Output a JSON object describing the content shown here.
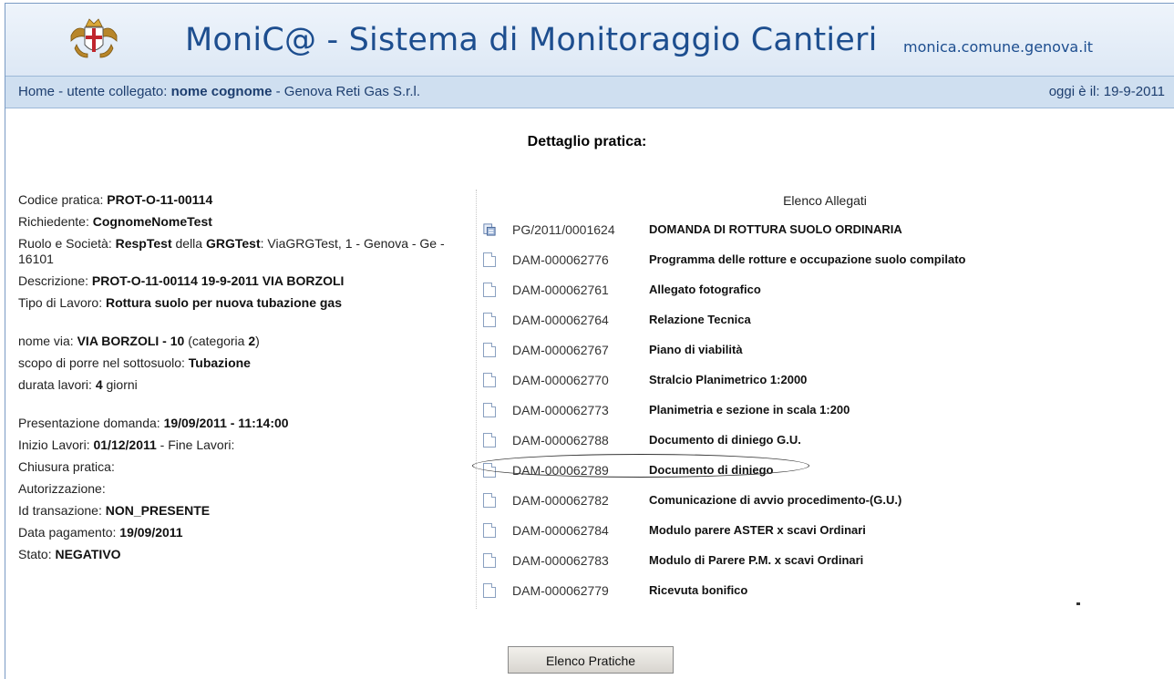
{
  "header": {
    "title": "MoniC@ - Sistema di Monitoraggio Cantieri",
    "url": "monica.comune.genova.it",
    "logo_icon": "genova-coat-of-arms-icon"
  },
  "nav": {
    "prefix": "Home - utente collegato: ",
    "user": "nome cognome",
    "company": " - Genova Reti Gas S.r.l.",
    "date_label": "oggi è il: 19-9-2011"
  },
  "page_heading": "Dettaglio pratica:",
  "details": {
    "codice_label": "Codice pratica: ",
    "codice": "PROT-O-11-00114",
    "richiedente_label": "Richiedente: ",
    "richiedente": "CognomeNomeTest",
    "ruolo_label": "Ruolo e Società: ",
    "ruolo": "RespTest",
    "della": " della ",
    "societa": "GRGTest",
    "indirizzo": ": ViaGRGTest, 1 - Genova - Ge - 16101",
    "descrizione_label": "Descrizione: ",
    "descrizione": "PROT-O-11-00114 19-9-2011 VIA BORZOLI",
    "tipo_label": "Tipo di Lavoro: ",
    "tipo": "Rottura suolo per nuova tubazione gas",
    "via_label": "nome via: ",
    "via": "VIA BORZOLI - 10",
    "categoria_pre": " (categoria ",
    "categoria": "2",
    "categoria_post": ")",
    "scopo_label": "scopo di porre nel sottosuolo: ",
    "scopo": "Tubazione",
    "durata_label": "durata lavori: ",
    "durata": "4",
    "durata_unit": " giorni",
    "presentazione_label": "Presentazione domanda: ",
    "presentazione": "19/09/2011 - 11:14:00",
    "inizio_label": "Inizio Lavori: ",
    "inizio": "01/12/2011",
    "fine_label": " - Fine Lavori:",
    "chiusura_label": "Chiusura pratica:",
    "autorizzazione_label": "Autorizzazione:",
    "transazione_label": "Id transazione: ",
    "transazione": "NON_PRESENTE",
    "pagamento_label": "Data pagamento: ",
    "pagamento": "19/09/2011",
    "stato_label": "Stato: ",
    "stato": "NEGATIVO"
  },
  "attachments": {
    "heading": "Elenco Allegati",
    "items": [
      {
        "code": "PG/2011/0001624",
        "title": "DOMANDA DI ROTTURA SUOLO ORDINARIA",
        "icon": "scanned-document-icon"
      },
      {
        "code": "DAM-000062776",
        "title": "Programma delle rotture e occupazione suolo compilato",
        "icon": "document-icon"
      },
      {
        "code": "DAM-000062761",
        "title": "Allegato fotografico",
        "icon": "document-icon"
      },
      {
        "code": "DAM-000062764",
        "title": "Relazione Tecnica",
        "icon": "document-icon"
      },
      {
        "code": "DAM-000062767",
        "title": "Piano di viabilità",
        "icon": "document-icon"
      },
      {
        "code": "DAM-000062770",
        "title": "Stralcio Planimetrico 1:2000",
        "icon": "document-icon"
      },
      {
        "code": "DAM-000062773",
        "title": "Planimetria e sezione in scala 1:200",
        "icon": "document-icon"
      },
      {
        "code": "DAM-000062788",
        "title": "Documento di diniego G.U.",
        "icon": "document-icon"
      },
      {
        "code": "DAM-000062789",
        "title": "Documento di diniego",
        "icon": "document-icon"
      },
      {
        "code": "DAM-000062782",
        "title": "Comunicazione di avvio procedimento-(G.U.)",
        "icon": "document-icon"
      },
      {
        "code": "DAM-000062784",
        "title": "Modulo parere ASTER x scavi Ordinari",
        "icon": "document-icon"
      },
      {
        "code": "DAM-000062783",
        "title": "Modulo di Parere P.M. x scavi Ordinari",
        "icon": "document-icon"
      },
      {
        "code": "DAM-000062779",
        "title": "Ricevuta bonifico",
        "icon": "document-icon"
      }
    ]
  },
  "button_label": "Elenco Pratiche",
  "colors": {
    "brand": "#1d4e8f",
    "nav_bg": "#cfdff0",
    "header_bg": "#e6eef8"
  }
}
